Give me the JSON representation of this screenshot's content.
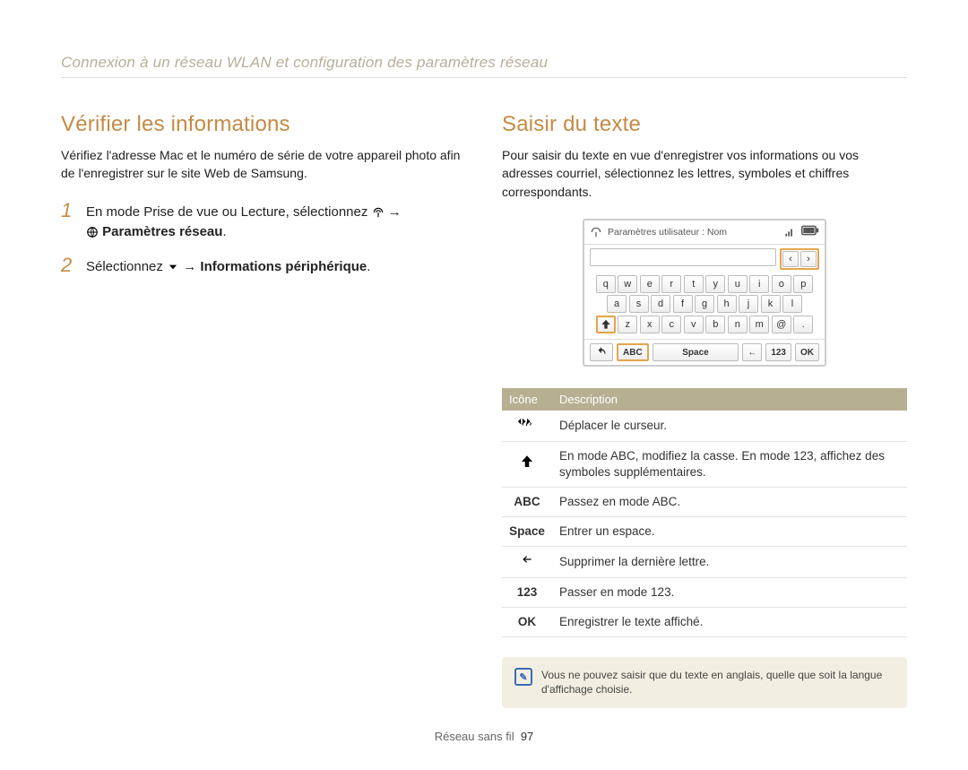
{
  "header": "Connexion à un réseau WLAN et configuration des paramètres réseau",
  "left": {
    "title": "Vérifier les informations",
    "desc": "Vérifiez l'adresse Mac et le numéro de série de votre appareil photo afin de l'enregistrer sur le site Web de Samsung.",
    "steps": [
      {
        "num": "1",
        "before": "En mode Prise de vue ou Lecture, sélectionnez ",
        "after": " → ",
        "bold": "Paramètres réseau",
        "boldsuffix": "."
      },
      {
        "num": "2",
        "before": "Sélectionnez ",
        "after": " → ",
        "bold": "Informations périphérique",
        "boldsuffix": "."
      }
    ]
  },
  "right": {
    "title": "Saisir du texte",
    "desc": "Pour saisir du texte en vue d'enregistrer vos informations ou vos adresses courriel, sélectionnez les lettres, symboles et chiffres correspondants.",
    "kb": {
      "title": "Paramètres utilisateur : Nom",
      "row1": [
        "q",
        "w",
        "e",
        "r",
        "t",
        "y",
        "u",
        "i",
        "o",
        "p"
      ],
      "row2": [
        "a",
        "s",
        "d",
        "f",
        "g",
        "h",
        "j",
        "k",
        "l"
      ],
      "row3": [
        "z",
        "x",
        "c",
        "v",
        "b",
        "n",
        "m",
        "@",
        "."
      ],
      "bottom": {
        "abc": "ABC",
        "space": "Space",
        "num": "123",
        "ok": "OK"
      }
    },
    "table": {
      "headers": {
        "icon": "Icône",
        "desc": "Description"
      },
      "rows": [
        {
          "icon_svg": "cursor",
          "desc": "Déplacer le curseur."
        },
        {
          "icon_svg": "shift",
          "desc": "En mode ABC, modifiez la casse. En mode 123, affichez des symboles supplémentaires."
        },
        {
          "icon_text": "ABC",
          "desc": "Passez en mode ABC."
        },
        {
          "icon_text": "Space",
          "desc": "Entrer un espace."
        },
        {
          "icon_svg": "back",
          "desc": "Supprimer la dernière lettre."
        },
        {
          "icon_text": "123",
          "desc": "Passer en mode 123."
        },
        {
          "icon_text": "OK",
          "desc": "Enregistrer le texte affiché."
        }
      ]
    },
    "note": "Vous ne pouvez saisir que du texte en anglais, quelle que soit la langue d'affichage choisie."
  },
  "footer": {
    "label": "Réseau sans fil",
    "page": "97"
  }
}
